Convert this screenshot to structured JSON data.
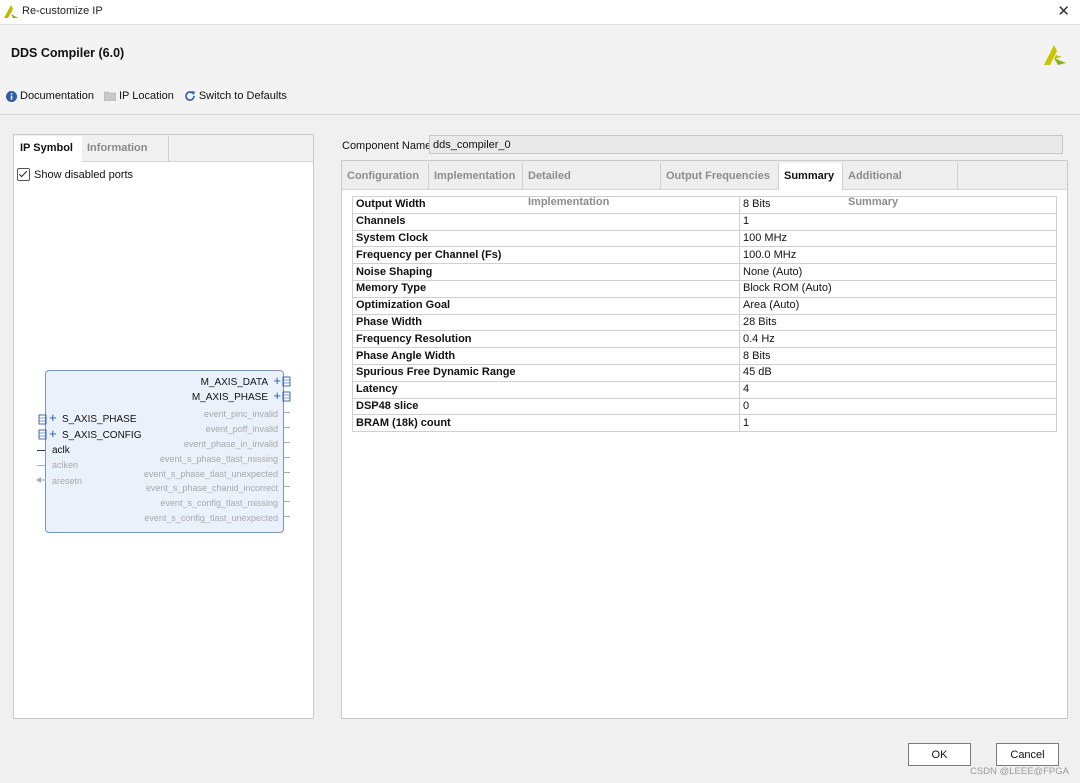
{
  "window": {
    "title": "Re-customize IP"
  },
  "header": {
    "ip_title": "DDS Compiler (6.0)"
  },
  "toolbar": {
    "documentation": "Documentation",
    "ip_location": "IP Location",
    "switch_defaults": "Switch to Defaults"
  },
  "left_tabs": [
    "IP Symbol",
    "Information"
  ],
  "show_disabled_ports": {
    "label": "Show disabled ports",
    "checked": true
  },
  "ip_symbol": {
    "outputs": [
      {
        "name": "M_AXIS_DATA",
        "enabled": true,
        "bus": true
      },
      {
        "name": "M_AXIS_PHASE",
        "enabled": true,
        "bus": true
      },
      {
        "name": "event_pinc_invalid",
        "enabled": false
      },
      {
        "name": "event_poff_invalid",
        "enabled": false
      },
      {
        "name": "event_phase_in_invalid",
        "enabled": false
      },
      {
        "name": "event_s_phase_tlast_missing",
        "enabled": false
      },
      {
        "name": "event_s_phase_tlast_unexpected",
        "enabled": false
      },
      {
        "name": "event_s_phase_chanid_incorrect",
        "enabled": false
      },
      {
        "name": "event_s_config_tlast_missing",
        "enabled": false
      },
      {
        "name": "event_s_config_tlast_unexpected",
        "enabled": false
      }
    ],
    "inputs": [
      {
        "name": "S_AXIS_PHASE",
        "enabled": true,
        "bus": true
      },
      {
        "name": "S_AXIS_CONFIG",
        "enabled": true,
        "bus": true
      },
      {
        "name": "aclk",
        "enabled": true
      },
      {
        "name": "aclken",
        "enabled": false
      },
      {
        "name": "aresetn",
        "enabled": false
      }
    ]
  },
  "component": {
    "label": "Component Name",
    "value": "dds_compiler_0"
  },
  "right_tabs": [
    "Configuration",
    "Implementation",
    "Detailed Implementation",
    "Output Frequencies",
    "Summary",
    "Additional Summary"
  ],
  "active_right_tab": "Summary",
  "summary_rows": [
    {
      "k": "Output Width",
      "v": "8 Bits"
    },
    {
      "k": "Channels",
      "v": "1"
    },
    {
      "k": "System Clock",
      "v": "100 MHz"
    },
    {
      "k": "Frequency per Channel (Fs)",
      "v": "100.0 MHz"
    },
    {
      "k": "Noise Shaping",
      "v": "None (Auto)"
    },
    {
      "k": "Memory Type",
      "v": "Block ROM (Auto)"
    },
    {
      "k": "Optimization Goal",
      "v": "Area (Auto)"
    },
    {
      "k": "Phase Width",
      "v": "28 Bits"
    },
    {
      "k": "Frequency Resolution",
      "v": "0.4 Hz"
    },
    {
      "k": "Phase Angle Width",
      "v": "8 Bits"
    },
    {
      "k": "Spurious Free Dynamic Range",
      "v": "45 dB"
    },
    {
      "k": "Latency",
      "v": "4"
    },
    {
      "k": "DSP48 slice",
      "v": "0"
    },
    {
      "k": "BRAM (18k) count",
      "v": "1"
    }
  ],
  "buttons": {
    "ok": "OK",
    "cancel": "Cancel"
  },
  "watermark": "CSDN @LEEE@FPGA",
  "colors": {
    "accent_blue": "#2f5da8",
    "brand_yellow": "#c8c400",
    "symbol_fill": "#eaf1fb"
  }
}
